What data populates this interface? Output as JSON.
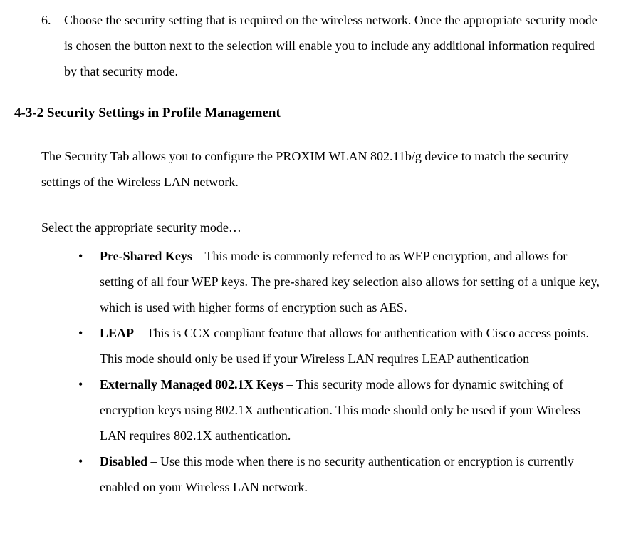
{
  "step": {
    "number": "6.",
    "text": "Choose the security setting that is required on the wireless network.  Once the appropriate security mode is chosen the button next to the selection will enable you to include any additional information required by that security mode."
  },
  "heading": "4-3-2 Security Settings in Profile Management",
  "intro": "The Security Tab allows you to configure the PROXIM WLAN 802.11b/g  device to match the security settings of the Wireless LAN network.",
  "selectLine": "Select the appropriate security mode…",
  "bullets": [
    {
      "title": "Pre-Shared Keys",
      "desc": " – This mode is commonly referred to as WEP encryption, and allows for setting of all four WEP keys.  The pre-shared key selection also allows for setting of a unique key, which is used with higher forms of encryption such as AES."
    },
    {
      "title": "LEAP",
      "desc": " – This is CCX compliant feature that allows for authentication with Cisco access points.  This mode should only be used if your Wireless LAN requires LEAP authentication"
    },
    {
      "title": "Externally Managed 802.1X Keys",
      "desc": " – This security mode allows for dynamic switching of encryption keys using 802.1X authentication.  This mode should only be used if your Wireless LAN requires 802.1X authentication."
    },
    {
      "title": "Disabled",
      "desc": " – Use this mode when there is no security authentication or encryption is currently enabled on your Wireless LAN network."
    }
  ]
}
